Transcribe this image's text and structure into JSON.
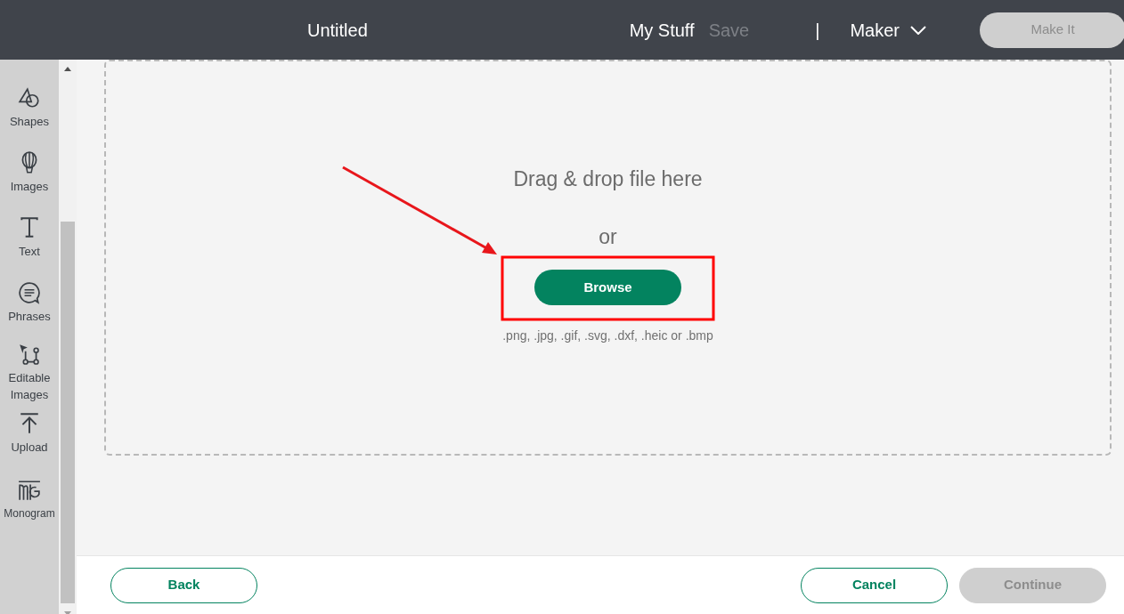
{
  "header": {
    "title": "Untitled",
    "nav": [
      {
        "label": "My Stuff",
        "disabled": false
      },
      {
        "label": "Save",
        "disabled": true
      }
    ],
    "separator": "|",
    "machine": {
      "label": "Maker"
    },
    "make_it": {
      "label": "Make It",
      "disabled": true
    }
  },
  "sidebar": {
    "items": [
      {
        "label": "Shapes",
        "kind": "shapes"
      },
      {
        "label": "Images",
        "kind": "images"
      },
      {
        "label": "Text",
        "kind": "text"
      },
      {
        "label": "Phrases",
        "kind": "phrases"
      },
      {
        "label": "Editable Images",
        "kind": "editable"
      },
      {
        "label": "Upload",
        "kind": "upload"
      },
      {
        "label": "Monogram",
        "kind": "monogram"
      }
    ]
  },
  "dropzone": {
    "heading": "Drag & drop file here",
    "or": "or",
    "browse": "Browse",
    "formats": ".png, .jpg, .gif, .svg, .dxf, .heic or .bmp"
  },
  "footer": {
    "back": {
      "label": "Back",
      "disabled": false
    },
    "cancel": {
      "label": "Cancel",
      "disabled": false
    },
    "continue": {
      "label": "Continue",
      "disabled": true
    }
  }
}
